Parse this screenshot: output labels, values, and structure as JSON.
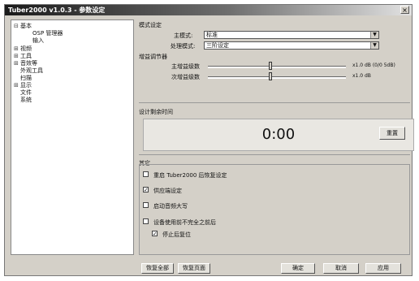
{
  "window": {
    "title": "Tuber2000 v1.0.3 - 参数设定",
    "close_glyph": "×"
  },
  "tree": {
    "items": [
      {
        "label": "基本",
        "expander": "⊟"
      },
      {
        "label": "OSP 管理器",
        "expander": ""
      },
      {
        "label": "输入",
        "expander": ""
      },
      {
        "label": "视频",
        "expander": "⊞"
      },
      {
        "label": "工具",
        "expander": "⊞"
      },
      {
        "label": "音效等",
        "expander": "⊞"
      },
      {
        "label": "外观工具",
        "expander": ""
      },
      {
        "label": "扫描",
        "expander": ""
      },
      {
        "label": "显示",
        "expander": "⊞"
      },
      {
        "label": "文件",
        "expander": ""
      },
      {
        "label": "系统",
        "expander": ""
      }
    ]
  },
  "mode_group": {
    "header": "模式设定",
    "main_mode_label": "主模式:",
    "main_mode_value": "标准",
    "sub_mode_label": "处理模式:",
    "sub_mode_value": "三阶设定"
  },
  "gain_group": {
    "header": "增益调节器",
    "slider1_label": "主增益级数",
    "slider1_value": 0.45,
    "slider1_readout": "x1.0 dB (0/0 5dB)",
    "slider2_label": "次增益级数",
    "slider2_value": 0.45,
    "slider2_readout": "x1.0 dB"
  },
  "timer_group": {
    "header": "设计剩余时间",
    "time": "0:00",
    "reset_label": "重置"
  },
  "other_group": {
    "header": "其它",
    "options": [
      {
        "label": "重启 Tuber2000 后恢复设定",
        "checked": false
      },
      {
        "label": "供应端设定",
        "checked": true
      },
      {
        "label": "启动音频大写",
        "checked": false
      },
      {
        "label": "设备使用前不完全之前后",
        "checked": false
      },
      {
        "label": "停止后复位",
        "checked": true
      }
    ]
  },
  "footer": {
    "restore_all": "恢复全部",
    "restore_page": "恢复页面",
    "ok": "确定",
    "cancel": "取消",
    "apply": "应用"
  },
  "check_glyph": "✓"
}
